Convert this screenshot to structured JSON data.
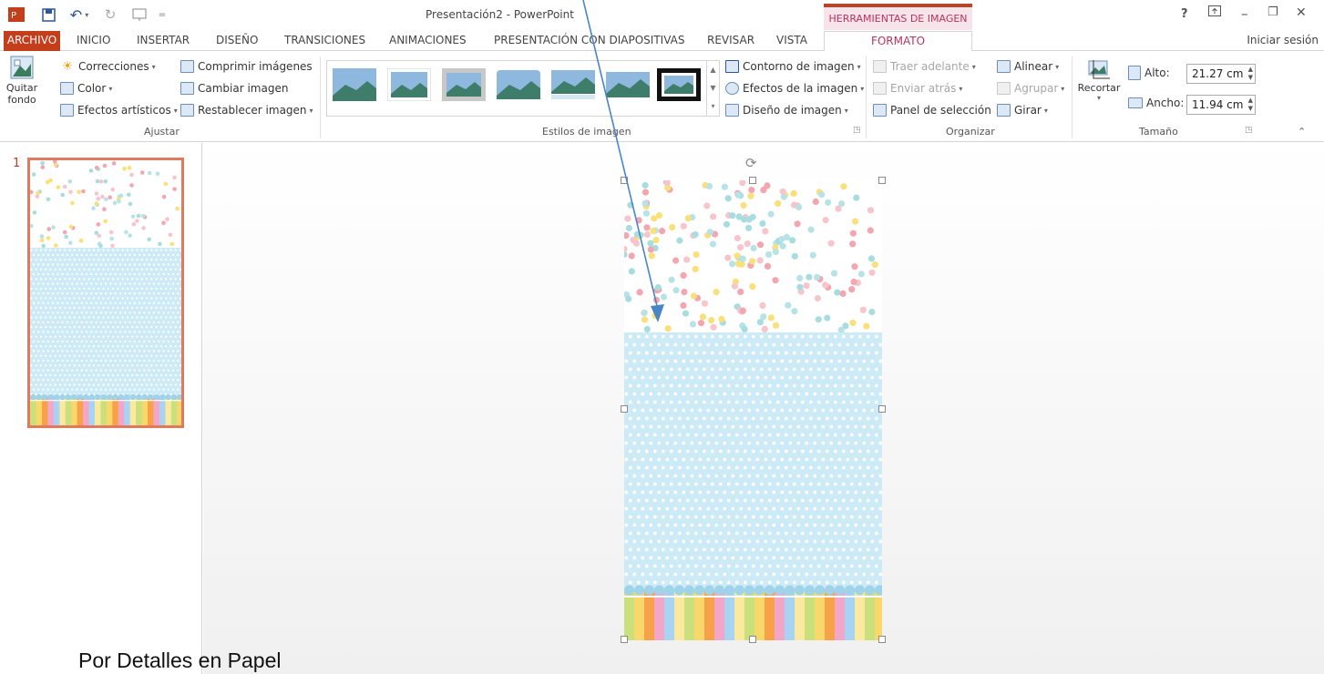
{
  "window": {
    "title": "Presentación2 - PowerPoint",
    "tools_label": "HERRAMIENTAS DE IMAGEN",
    "controls": {
      "help": "?",
      "restore_ribbon": "⌃",
      "minimize": "–",
      "restore": "❐",
      "close": "✕"
    }
  },
  "tabs": {
    "file": "ARCHIVO",
    "items": [
      "INICIO",
      "INSERTAR",
      "DISEÑO",
      "TRANSICIONES",
      "ANIMACIONES",
      "PRESENTACIÓN CON DIAPOSITIVAS",
      "REVISAR",
      "VISTA"
    ],
    "active": "FORMATO",
    "signin": "Iniciar sesión"
  },
  "ribbon": {
    "ajustar": {
      "label": "Ajustar",
      "quitar_fondo_1": "Quitar",
      "quitar_fondo_2": "fondo",
      "correcciones": "Correcciones",
      "color": "Color",
      "efectos_artisticos": "Efectos artísticos",
      "comprimir": "Comprimir imágenes",
      "cambiar": "Cambiar imagen",
      "restablecer": "Restablecer imagen"
    },
    "estilos": {
      "label": "Estilos de imagen",
      "contorno": "Contorno de imagen",
      "efectos": "Efectos de la imagen",
      "diseno": "Diseño de imagen"
    },
    "organizar": {
      "label": "Organizar",
      "traer": "Traer adelante",
      "enviar": "Enviar atrás",
      "panel": "Panel de selección",
      "alinear": "Alinear",
      "agrupar": "Agrupar",
      "girar": "Girar"
    },
    "tamano": {
      "label": "Tamaño",
      "recortar": "Recortar",
      "alto_label": "Alto:",
      "alto_value": "21.27 cm",
      "ancho_label": "Ancho:",
      "ancho_value": "11.94 cm"
    }
  },
  "thumbnails": {
    "slide_number": "1"
  },
  "caption": "Por Detalles en Papel",
  "colors": {
    "accent": "#c43e1c",
    "picture_tools": "#b7335c",
    "dot_palette": [
      "#f4a6b0",
      "#f9e07a",
      "#a8dde0",
      "#f7c5cc",
      "#b8e3e6"
    ],
    "grid_bg": "#cdeaf7",
    "stripes": [
      "#c9e07c",
      "#f9d86b",
      "#f7a24b",
      "#f4a6c8",
      "#a6d4f2",
      "#fbe9a0"
    ],
    "arrow": "#4a86c5"
  }
}
